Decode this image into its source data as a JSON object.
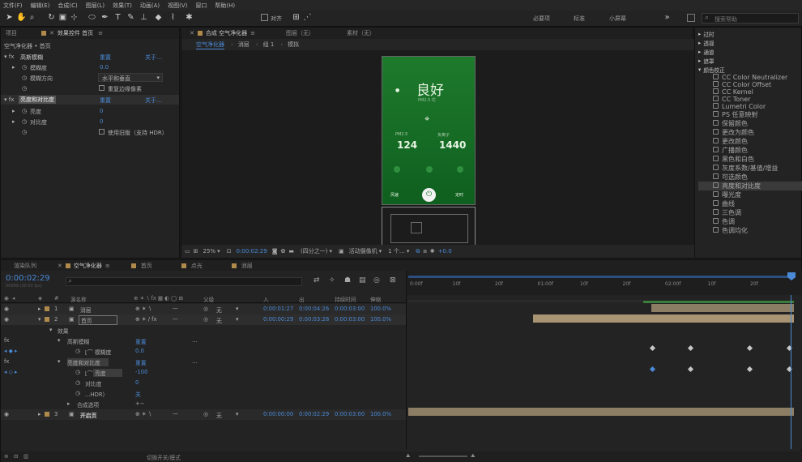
{
  "menu": [
    "文件(F)",
    "编辑(E)",
    "合成(C)",
    "图层(L)",
    "效果(T)",
    "动画(A)",
    "视图(V)",
    "窗口",
    "帮助(H)"
  ],
  "toolbar": {
    "align_label": "对齐",
    "workspaces": [
      "必要项",
      "标准",
      "小屏幕"
    ],
    "search_placeholder": "搜索帮助"
  },
  "left_panel": {
    "tab_project": "项目",
    "tab_effects": "效果控件 首页",
    "layer_path": "空气净化器 • 首页",
    "effects": [
      {
        "name": "高斯模糊",
        "reset": "重置",
        "about": "关于…",
        "props": [
          {
            "label": "模糊度",
            "value": "0.0"
          },
          {
            "label": "模糊方向",
            "value": "水平和垂直"
          },
          {
            "label": "重复边缘像素",
            "value": ""
          }
        ]
      },
      {
        "name": "亮度和对比度",
        "reset": "重置",
        "about": "关于…",
        "props": [
          {
            "label": "亮度",
            "value": "0"
          },
          {
            "label": "对比度",
            "value": "0"
          },
          {
            "label": "使用旧版（支持 HDR）",
            "value": ""
          }
        ]
      }
    ]
  },
  "comp_panel": {
    "tabs": [
      "合成 空气净化器",
      "图层（无）",
      "素材（无）"
    ],
    "breadcrumbs": [
      "空气净化器",
      "消层",
      "组 1",
      "模拟"
    ],
    "phone": {
      "status": "良好",
      "substatus": "PM2.5 优",
      "metric1_label": "PM2.5",
      "metric1": "124",
      "metric2_label": "负离子",
      "metric2": "1440",
      "btn_left": "风速",
      "btn_right": "定时"
    },
    "footer": {
      "zoom": "25%",
      "time": "0:00:02:29",
      "quality": "(四分之一)",
      "camera": "活动摄像机",
      "views": "1 个…",
      "exposure": "+0.0"
    }
  },
  "right_panel": {
    "categories": [
      "过时",
      "透视",
      "通道",
      "遮罩",
      "颜色校正"
    ],
    "effects": [
      "CC Color Neutralizer",
      "CC Color Offset",
      "CC Kernel",
      "CC Toner",
      "Lumetri Color",
      "PS 任意映射",
      "保留颜色",
      "更改为颜色",
      "更改颜色",
      "广播颜色",
      "黑色和白色",
      "灰度系数/基值/增益",
      "可选颜色",
      "亮度和对比度",
      "曝光度",
      "曲线",
      "三色调",
      "色调",
      "色调均化"
    ],
    "selected": "亮度和对比度"
  },
  "timeline": {
    "tabs": [
      "渲染队列",
      "空气净化器",
      "首页",
      "点光",
      "消层"
    ],
    "timecode": "0:00:02:29",
    "timecode_sub": "00089 (30.00 fps)",
    "headers": {
      "source": "源名称",
      "parent": "父级",
      "in": "入",
      "out": "出",
      "duration": "持续时间",
      "stretch": "伸缩"
    },
    "ruler": [
      "0:00f",
      "10f",
      "20f",
      "01:00f",
      "10f",
      "20f",
      "02:00f",
      "10f",
      "20f"
    ],
    "layers": [
      {
        "num": "1",
        "name": "消层",
        "parent": "无",
        "in": "0:00:01:27",
        "out": "0:00:04:26",
        "dur": "0:00:03:00",
        "stretch": "100.0%"
      },
      {
        "num": "2",
        "name": "首页",
        "parent": "无",
        "in": "0:00:00:29",
        "out": "0:00:03:28",
        "dur": "0:00:03:00",
        "stretch": "100.0%"
      },
      {
        "num": "3",
        "name": "开启页",
        "parent": "无",
        "in": "0:00:00:00",
        "out": "0:00:02:29",
        "dur": "0:00:03:00",
        "stretch": "100.0%"
      }
    ],
    "props": {
      "effects": "效果",
      "blur": "高斯模糊",
      "blur_reset": "重置",
      "blur_amount_label": "模糊度",
      "blur_amount": "0.0",
      "bc": "亮度和对比度",
      "bc_reset": "重置",
      "brightness_label": "亮度",
      "brightness": "-100",
      "contrast_label": "对比度",
      "contrast": "0",
      "legacy_label": "...HDR）",
      "legacy": "关",
      "composite": "合成选项"
    },
    "footer": "切换开关/模式"
  }
}
